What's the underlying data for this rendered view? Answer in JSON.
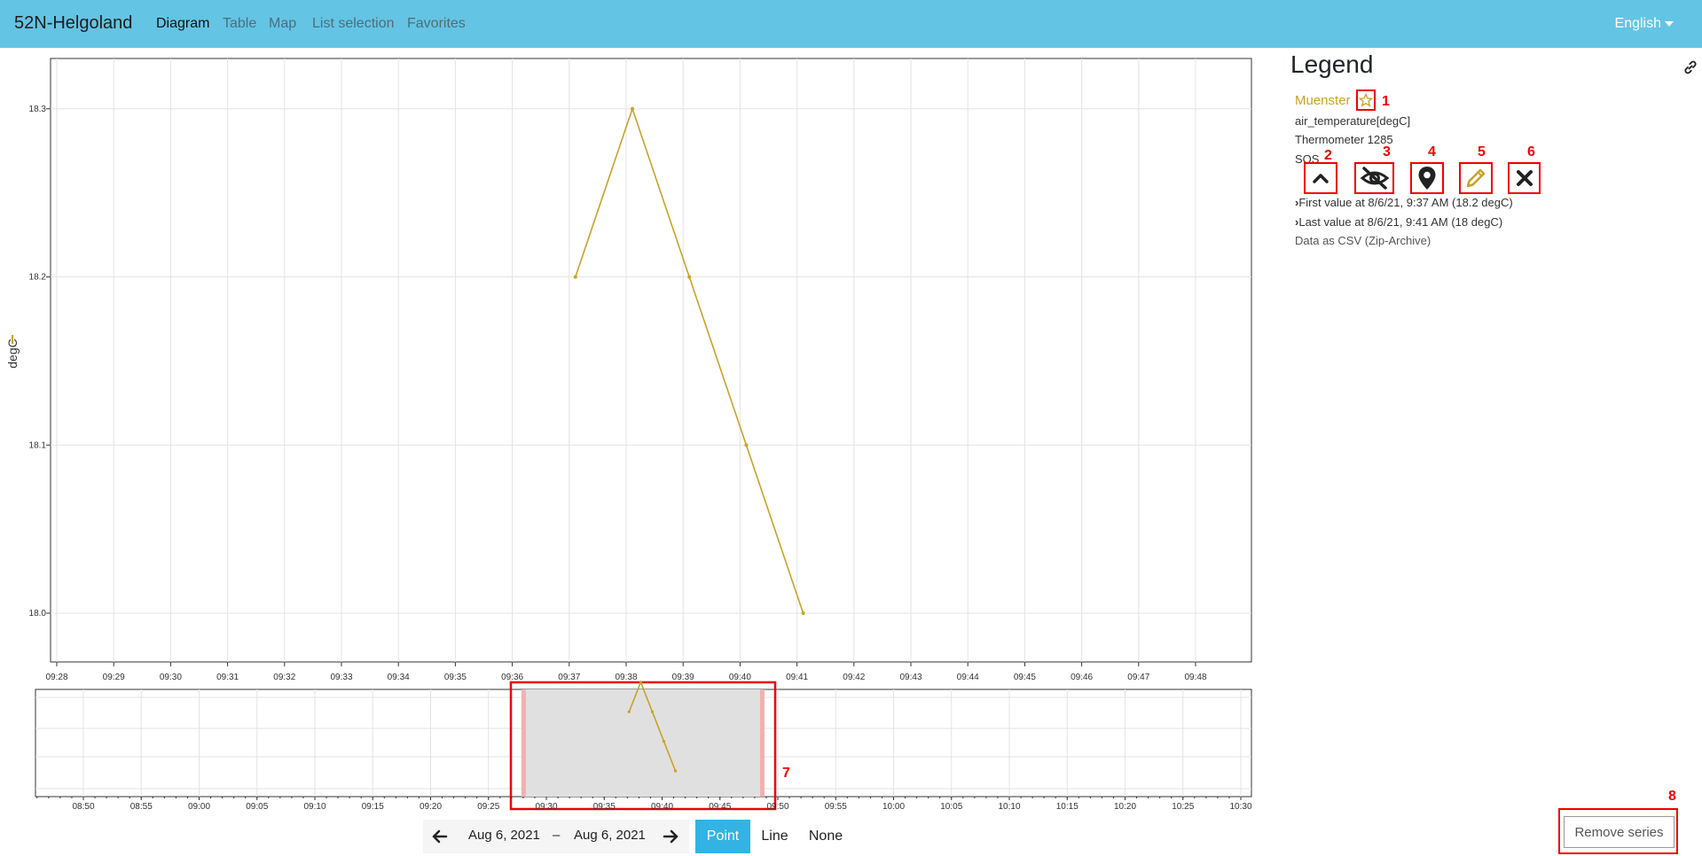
{
  "navbar": {
    "brand": "52N-Helgoland",
    "links": [
      "Diagram",
      "Table",
      "Map",
      "List selection",
      "Favorites"
    ],
    "active": "Diagram",
    "language": "English",
    "bg_color": "#64c4e4"
  },
  "chart_data": {
    "type": "line",
    "ylabel": "degC",
    "ylim": [
      17.96,
      18.33
    ],
    "yticks": [
      "18.0",
      "18.1",
      "18.2",
      "18.3"
    ],
    "xticks": [
      "09:28",
      "09:29",
      "09:30",
      "09:31",
      "09:32",
      "09:33",
      "09:34",
      "09:35",
      "09:36",
      "09:37",
      "09:38",
      "09:39",
      "09:40",
      "09:41",
      "09:42",
      "09:43",
      "09:44",
      "09:45",
      "09:46",
      "09:47",
      "09:48"
    ],
    "series": [
      {
        "color": "#c9a227",
        "x": [
          "09:37",
          "09:38",
          "09:39",
          "09:40",
          "09:41"
        ],
        "values": [
          18.2,
          18.3,
          18.2,
          18.1,
          18.0
        ]
      }
    ],
    "grid": true
  },
  "overview_chart": {
    "type": "line",
    "xticks": [
      "08:50",
      "08:55",
      "09:00",
      "09:05",
      "09:10",
      "09:15",
      "09:20",
      "09:25",
      "09:30",
      "09:35",
      "09:40",
      "09:45",
      "09:50",
      "09:55",
      "10:00",
      "10:05",
      "10:10",
      "10:15",
      "10:20",
      "10:25",
      "10:30"
    ],
    "selection": [
      "09:28",
      "09:49"
    ],
    "annotation": "7"
  },
  "legend": {
    "title": "Legend",
    "station": "Muenster",
    "phenomenon": "air_temperature[degC]",
    "sensor": "Thermometer 1285",
    "provider": "SOS",
    "actions": [
      {
        "icon": "chevron-up-icon",
        "annotation": "2"
      },
      {
        "icon": "eye-slash-icon",
        "annotation": "3"
      },
      {
        "icon": "map-marker-icon",
        "annotation": "4"
      },
      {
        "icon": "pencil-icon",
        "annotation": "5"
      },
      {
        "icon": "close-icon",
        "annotation": "6"
      }
    ],
    "star_annotation": "1",
    "first_value": "First value at 8/6/21, 9:37 AM (18.2 degC)",
    "last_value": "Last value at 8/6/21, 9:41 AM (18 degC)",
    "csv": "Data as CSV (Zip-Archive)"
  },
  "timespan": {
    "start": "Aug 6, 2021",
    "separator": "–",
    "end": "Aug 6, 2021"
  },
  "display_modes": [
    "Point",
    "Line",
    "None"
  ],
  "active_mode": "Point",
  "remove": {
    "label": "Remove series",
    "annotation": "8"
  }
}
